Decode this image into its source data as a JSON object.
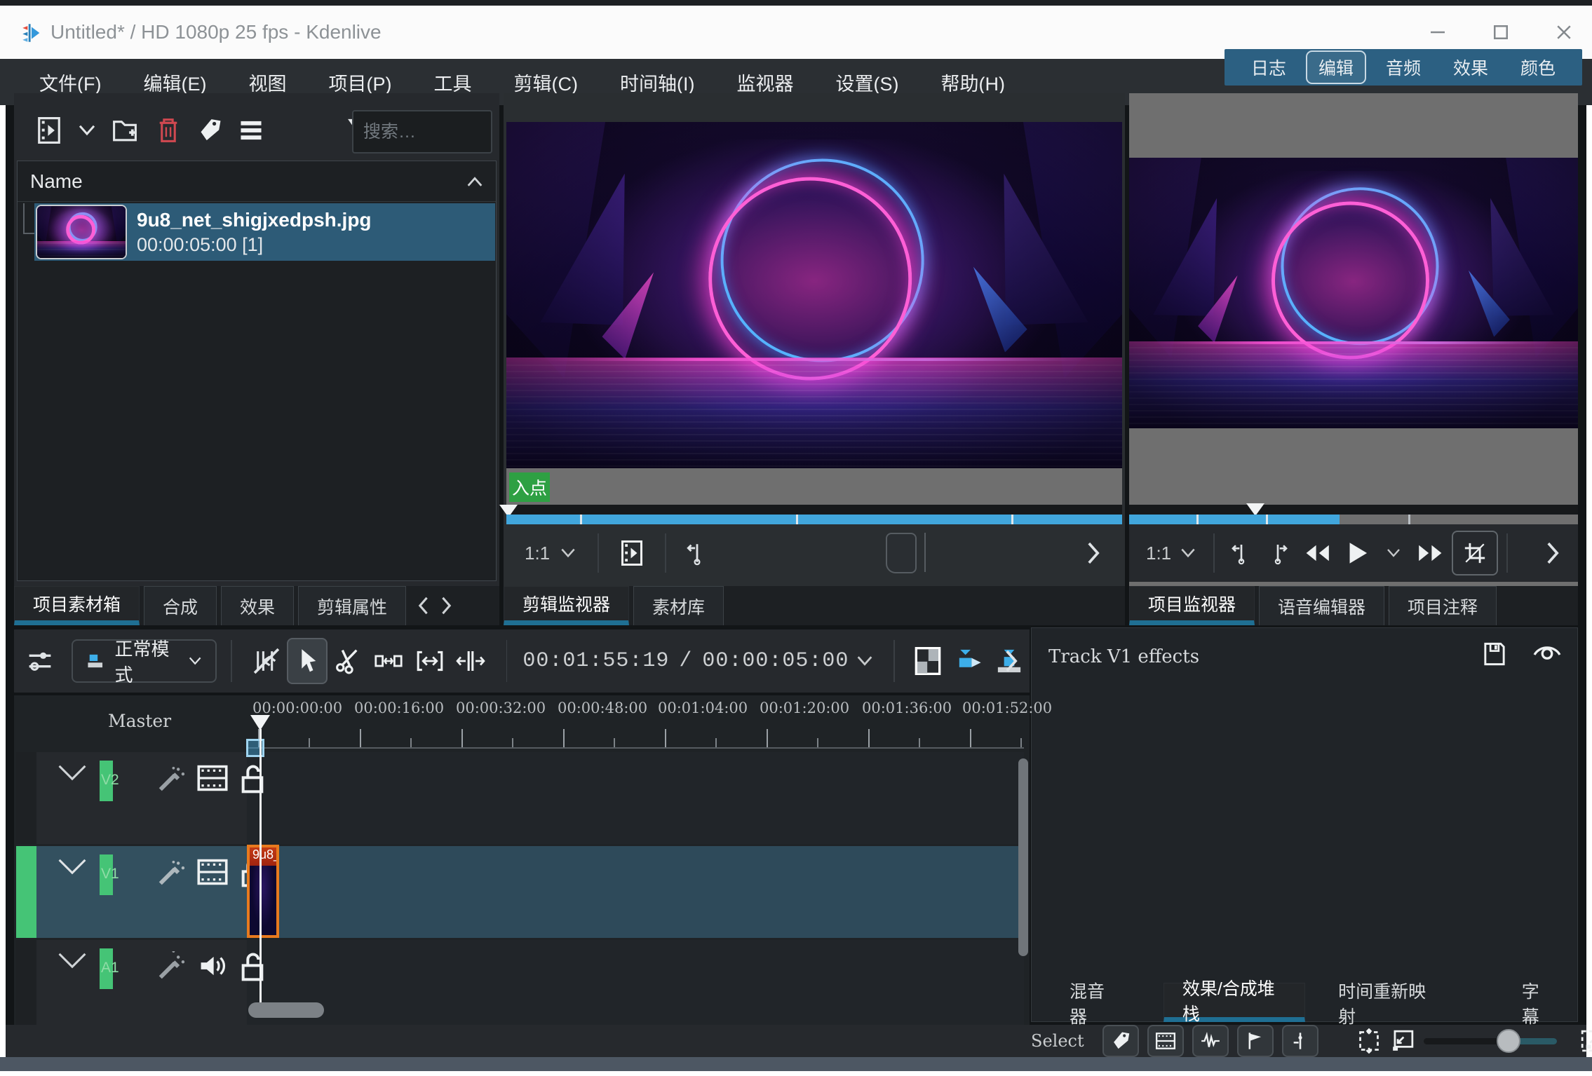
{
  "window": {
    "title": "Untitled* / HD 1080p 25 fps - Kdenlive"
  },
  "menu": {
    "items": [
      "文件(F)",
      "编辑(E)",
      "视图",
      "项目(P)",
      "工具",
      "剪辑(C)",
      "时间轴(I)",
      "监视器",
      "设置(S)",
      "帮助(H)"
    ]
  },
  "workspace_switcher": {
    "items": [
      "日志",
      "编辑",
      "音频",
      "效果",
      "颜色"
    ],
    "active": "编辑"
  },
  "project_bin": {
    "search_placeholder": "搜索…",
    "name_header": "Name",
    "clip": {
      "filename": "9u8_net_shigjxedpsh.jpg",
      "duration": "00:00:05:00 [1]"
    }
  },
  "tabs": {
    "bin_area": [
      "项目素材箱",
      "合成",
      "效果",
      "剪辑属性"
    ],
    "bin_area_active": "项目素材箱",
    "clip_monitor_area": [
      "剪辑监视器",
      "素材库"
    ],
    "clip_monitor_area_active": "剪辑监视器",
    "project_monitor_area": [
      "项目监视器",
      "语音编辑器",
      "项目注释"
    ],
    "project_monitor_area_active": "项目监视器",
    "effects_area": [
      "混音器",
      "效果/合成堆栈",
      "时间重新映射",
      "字幕"
    ],
    "effects_area_active": "效果/合成堆栈"
  },
  "clip_monitor": {
    "in_point_badge": "入点",
    "zoom_level": "1:1"
  },
  "project_monitor": {
    "zoom_level": "1:1"
  },
  "timeline_toolbar": {
    "mode": "正常模式",
    "timecode_current": "00:01:55:19",
    "timecode_separator": "/",
    "timecode_total": "00:00:05:00"
  },
  "effects_panel": {
    "title": "Track V1 effects"
  },
  "timeline": {
    "master_label": "Master",
    "ruler_labels": [
      "00:00:00:00",
      "00:00:16:00",
      "00:00:32:00",
      "00:00:48:00",
      "00:01:04:00",
      "00:01:20:00",
      "00:01:36:00",
      "00:01:52:00"
    ],
    "tracks": [
      {
        "id": "V2"
      },
      {
        "id": "V1"
      },
      {
        "id": "A1"
      }
    ],
    "clip_label": "9u8_"
  },
  "status_bar": {
    "select_label": "Select"
  },
  "colors": {
    "accent_blue": "#3daee9",
    "zone_blue": "#41a6dc",
    "in_point_green": "#2ea043",
    "selection_blue": "#2d5b77",
    "clip_border_orange": "#e87a1e",
    "delete_red": "#cf4850",
    "workspace_bar": "#2c6082",
    "target_green": "#45c476"
  }
}
